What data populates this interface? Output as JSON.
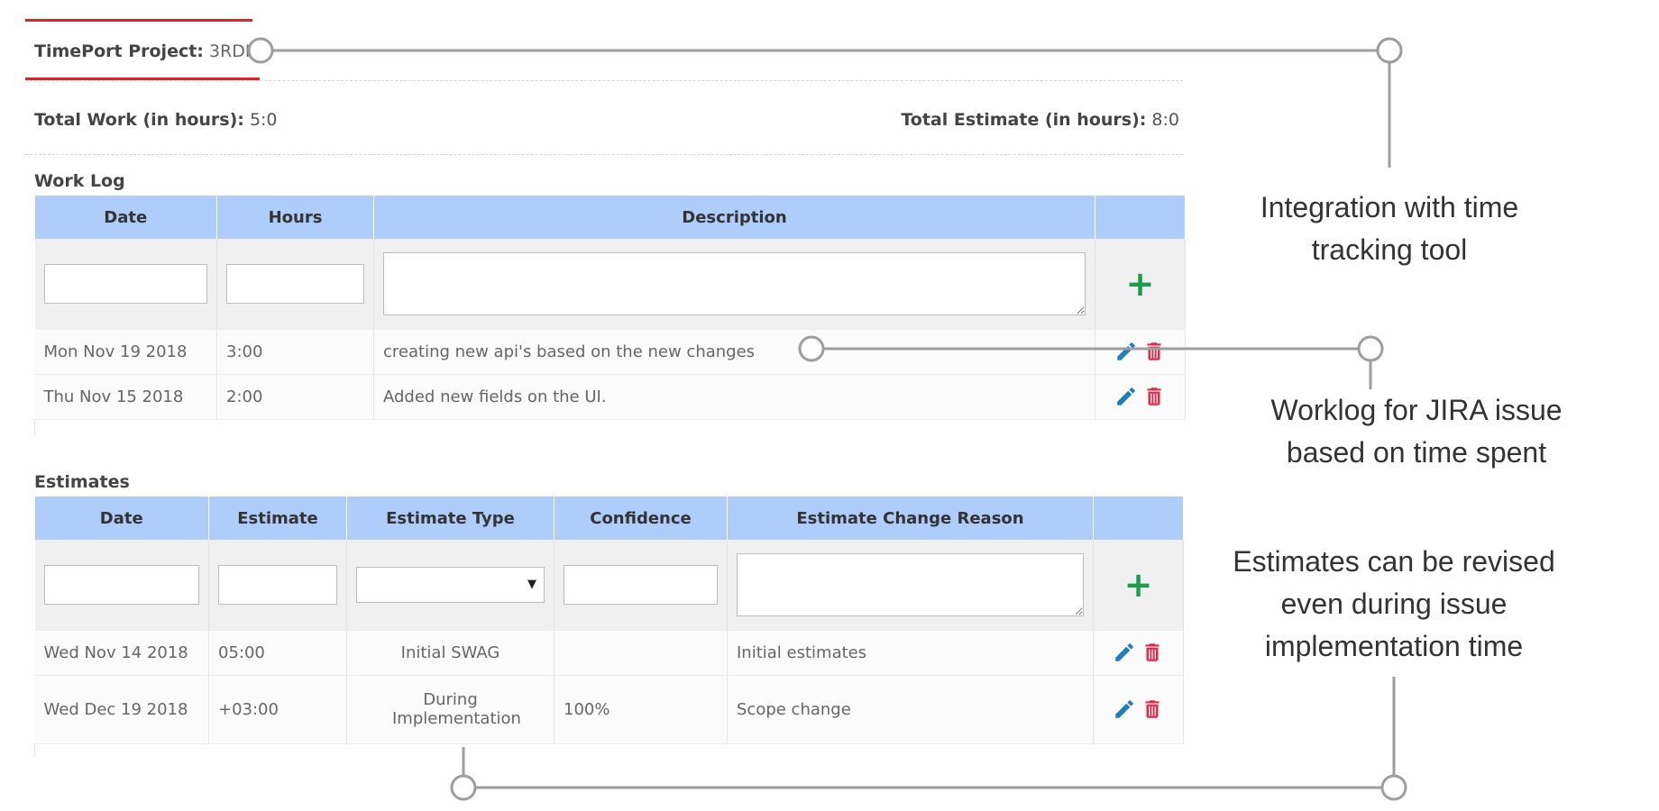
{
  "project": {
    "label": "TimePort Project:",
    "value": "3RDI"
  },
  "totals": {
    "work_label": "Total Work (in hours):",
    "work_value": "5:0",
    "estimate_label": "Total Estimate (in hours):",
    "estimate_value": "8:0"
  },
  "worklog": {
    "title": "Work Log",
    "columns": [
      "Date",
      "Hours",
      "Description",
      ""
    ],
    "add_icon": "plus-icon",
    "rows": [
      {
        "date": "Mon Nov 19 2018",
        "hours": "3:00",
        "description": "creating new api's based on the new changes"
      },
      {
        "date": "Thu Nov 15 2018",
        "hours": "2:00",
        "description": "Added new fields on the UI."
      }
    ]
  },
  "estimates": {
    "title": "Estimates",
    "columns": [
      "Date",
      "Estimate",
      "Estimate Type",
      "Confidence",
      "Estimate Change Reason",
      ""
    ],
    "select_selected": "",
    "rows": [
      {
        "date": "Wed Nov 14 2018",
        "estimate": "05:00",
        "type": "Initial SWAG",
        "confidence": "",
        "reason": "Initial estimates"
      },
      {
        "date": "Wed Dec 19 2018",
        "estimate": "+03:00",
        "type": "During Implementation",
        "confidence": "100%",
        "reason": "Scope change"
      }
    ]
  },
  "callouts": {
    "integration": [
      "Integration with time",
      "tracking tool"
    ],
    "worklog": [
      "Worklog for JIRA issue",
      "based on time spent"
    ],
    "estimates": [
      "Estimates can be revised",
      "even during issue",
      "implementation time"
    ]
  },
  "icons": {
    "edit": "pencil-icon",
    "delete": "trash-icon",
    "add": "plus-icon"
  },
  "colors": {
    "header_bg": "#aecdfb",
    "accent_red": "#d9262b",
    "add_green": "#1c9a4e",
    "edit_blue": "#1f7fb8",
    "delete_red": "#e0294b",
    "connector": "#9e9e9e"
  }
}
